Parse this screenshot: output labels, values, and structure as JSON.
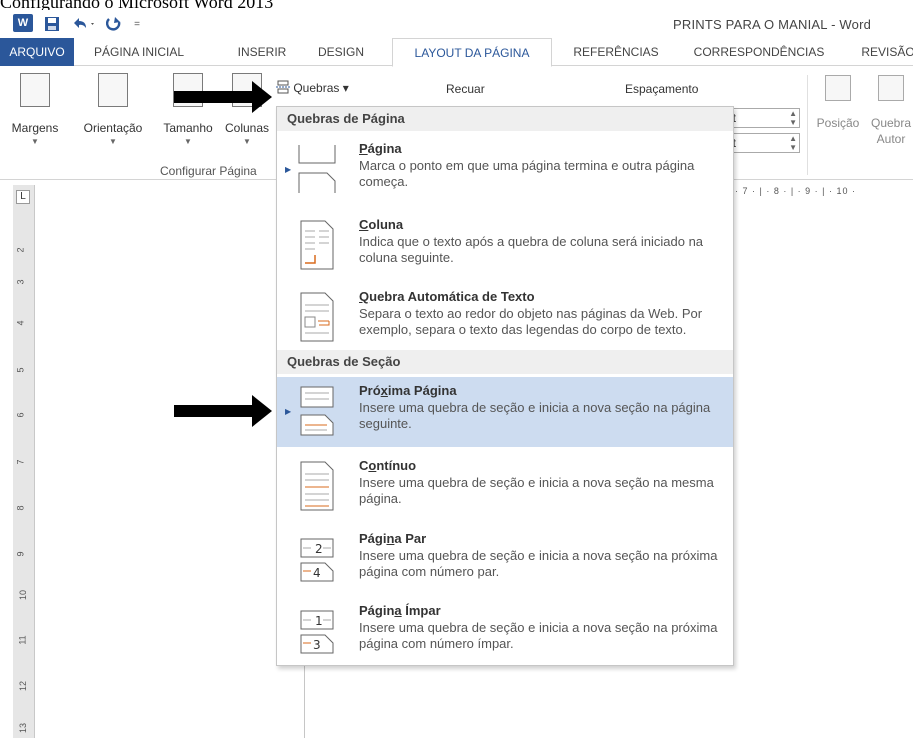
{
  "caption": "Configurando o Microsoft Word 2013",
  "window": {
    "title": "PRINTS PARA O MANIAL - Word",
    "app_icon": "W"
  },
  "qat": {
    "save_icon": "save-icon",
    "undo_icon": "undo-icon",
    "redo_icon": "redo-icon",
    "customize_icon": "customize-qat-icon"
  },
  "tabs": [
    {
      "label": "ARQUIVO"
    },
    {
      "label": "PÁGINA INICIAL"
    },
    {
      "label": "INSERIR"
    },
    {
      "label": "DESIGN"
    },
    {
      "label": "LAYOUT DA PÁGINA"
    },
    {
      "label": "REFERÊNCIAS"
    },
    {
      "label": "CORRESPONDÊNCIAS"
    },
    {
      "label": "REVISÃO"
    }
  ],
  "ribbon": {
    "buttons": [
      {
        "label": "Margens"
      },
      {
        "label": "Orientação"
      },
      {
        "label": "Tamanho"
      },
      {
        "label": "Colunas"
      }
    ],
    "group_label": "Configurar Página",
    "breaks_button": "Quebras ▾",
    "indent_label": "Recuar",
    "spacing_label": "Espaçamento",
    "spin1": "pt",
    "spin2": "pt",
    "position_label": "Posição",
    "wrap_label": "Quebra",
    "wrap_label2": "Autor"
  },
  "ruler": {
    "corner": "L",
    "vertical_marks": [
      "2",
      "3",
      "4",
      "5",
      "6",
      "7",
      "8",
      "9",
      "10",
      "11",
      "12",
      "13"
    ],
    "horizontal": "· 7 · | · 8 · | · 9 · | · 10 ·"
  },
  "dropdown": {
    "section1": "Quebras de Página",
    "section2": "Quebras de Seção",
    "items": [
      {
        "title": "Página",
        "underline": "P",
        "rest": "ágina",
        "desc": "Marca o ponto em que uma página termina e outra página começa."
      },
      {
        "title": "Coluna",
        "underline": "C",
        "rest": "oluna",
        "desc": "Indica que o texto após a quebra de coluna será iniciado na coluna seguinte."
      },
      {
        "title": "Quebra Automática de Texto",
        "underline": "Q",
        "rest": "uebra Automática de Texto",
        "desc": "Separa o texto ao redor do objeto nas páginas da Web. Por exemplo, separa o texto das legendas do corpo de texto."
      },
      {
        "title": "Próxima Página",
        "pre": "Pró",
        "underline": "x",
        "rest": "ima Página",
        "desc": "Insere uma quebra de seção e inicia a nova seção na página seguinte."
      },
      {
        "title": "Contínuo",
        "pre": "C",
        "underline": "o",
        "rest": "ntínuo",
        "desc": "Insere uma quebra de seção e inicia a nova seção na mesma página."
      },
      {
        "title": "Página Par",
        "pre": "Pági",
        "underline": "n",
        "rest": "a Par",
        "desc": "Insere uma quebra de seção e inicia a nova seção na próxima página com número par."
      },
      {
        "title": "Página Ímpar",
        "pre": "Págin",
        "underline": "a",
        "rest": " Ímpar",
        "desc": "Insere uma quebra de seção e inicia a nova seção na próxima página com número ímpar."
      }
    ]
  },
  "colors": {
    "accent": "#2b579a",
    "selected": "#cddcf0"
  }
}
